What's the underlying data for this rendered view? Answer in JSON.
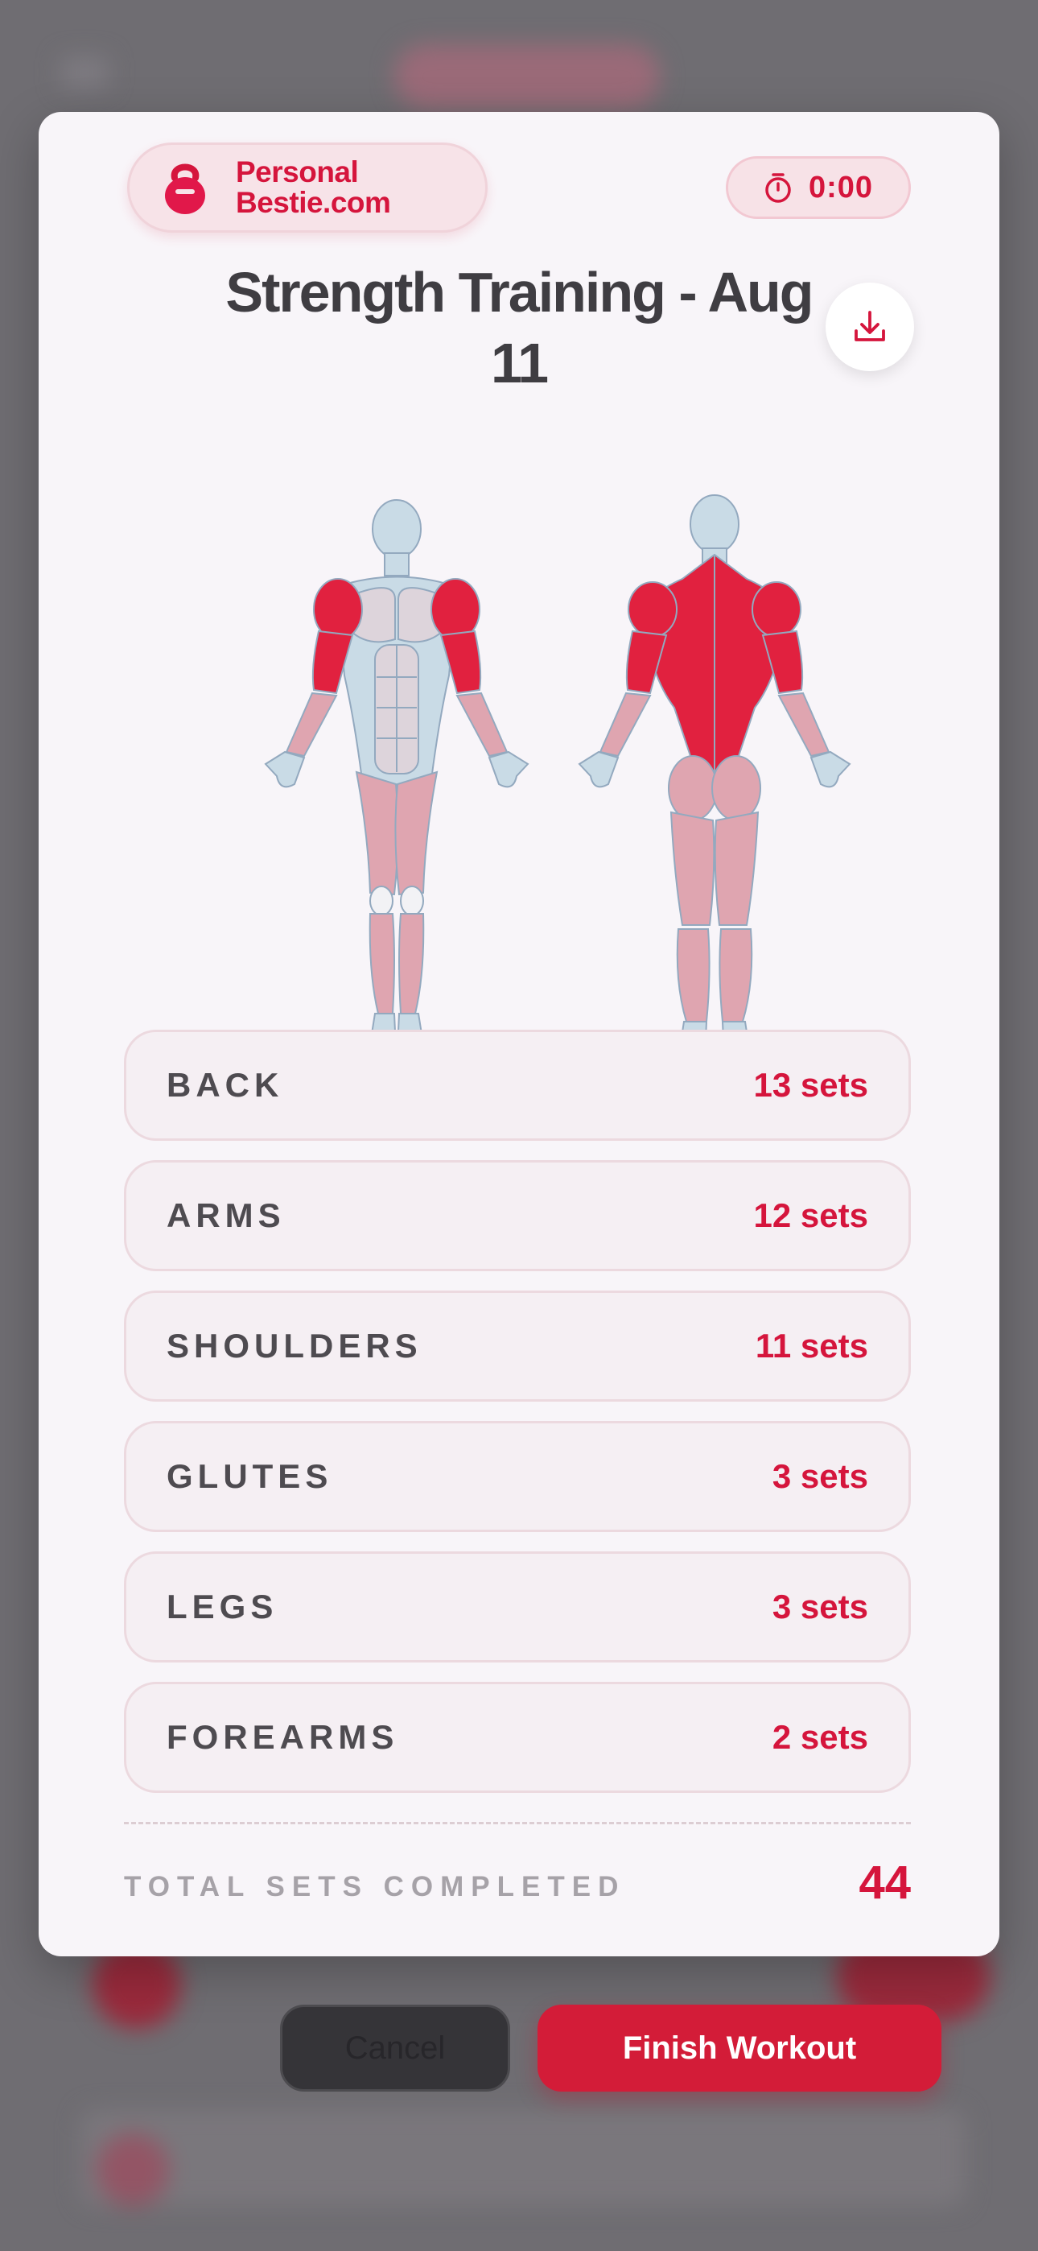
{
  "brand": {
    "line1": "Personal",
    "line2": "Bestie.com",
    "icon": "kettlebell-icon"
  },
  "timer": {
    "value": "0:00",
    "icon": "stopwatch-icon"
  },
  "title": "Strength Training - Aug 11",
  "download": {
    "icon": "download-icon"
  },
  "muscles": [
    {
      "name": "BACK",
      "sets": "13 sets"
    },
    {
      "name": "ARMS",
      "sets": "12 sets"
    },
    {
      "name": "SHOULDERS",
      "sets": "11 sets"
    },
    {
      "name": "GLUTES",
      "sets": "3 sets"
    },
    {
      "name": "LEGS",
      "sets": "3 sets"
    },
    {
      "name": "FOREARMS",
      "sets": "2 sets"
    }
  ],
  "total": {
    "label": "TOTAL SETS COMPLETED",
    "value": "44"
  },
  "actions": {
    "cancel": "Cancel",
    "finish": "Finish Workout"
  },
  "colors": {
    "accent": "#d5153c",
    "muscle_high": "#e1213f",
    "muscle_low": "#dfa5b0",
    "body_base": "#c9dbe6"
  }
}
